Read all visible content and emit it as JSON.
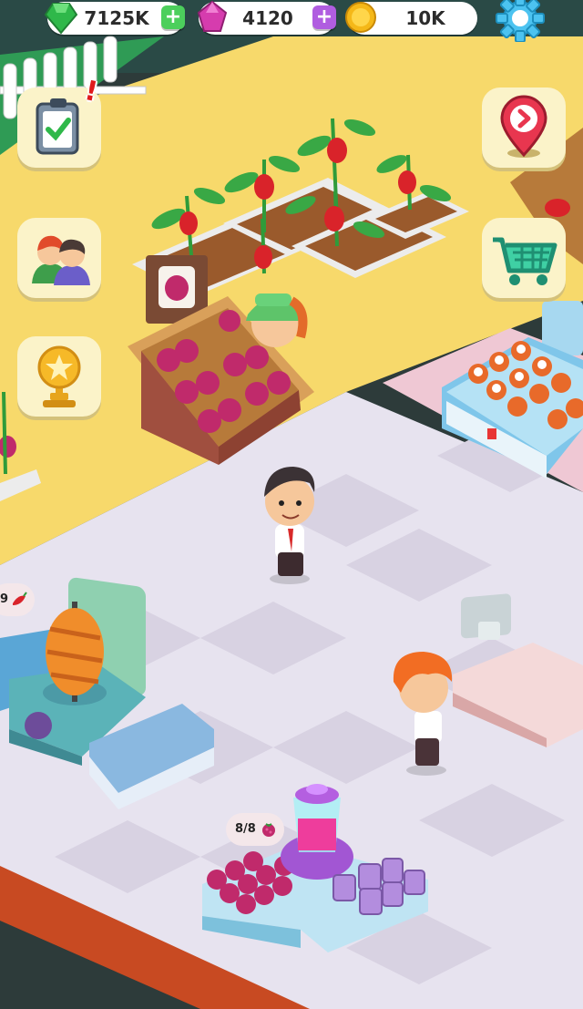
{
  "hud": {
    "gems": {
      "value": "7125K",
      "icon": "green-gem-icon",
      "color": "#2fb84a"
    },
    "crystals": {
      "value": "4120",
      "icon": "pink-crystal-icon",
      "color": "#d63cae"
    },
    "coins": {
      "value": "10K",
      "icon": "gold-coin-icon",
      "color": "#f5b818"
    },
    "plus_label": "+",
    "settings_icon": "gear-icon"
  },
  "left_menu": [
    {
      "name": "tasks",
      "icon": "clipboard-check-icon",
      "has_alert": true,
      "alert": "!"
    },
    {
      "name": "staff",
      "icon": "customers-icon"
    },
    {
      "name": "achievements",
      "icon": "trophy-star-icon"
    }
  ],
  "right_menu": [
    {
      "name": "location",
      "icon": "map-pin-arrow-icon"
    },
    {
      "name": "shop",
      "icon": "shopping-cart-icon"
    }
  ],
  "stations": {
    "kebab_bubble": {
      "text": "9",
      "icon": "chili-pepper-icon"
    },
    "juice_bubble": {
      "text": "8/8",
      "icon": "raspberry-icon"
    }
  },
  "colors": {
    "floor": "#e7e3ef",
    "grass": "#f7d96b",
    "ui_panel": "#fbf3c9"
  }
}
